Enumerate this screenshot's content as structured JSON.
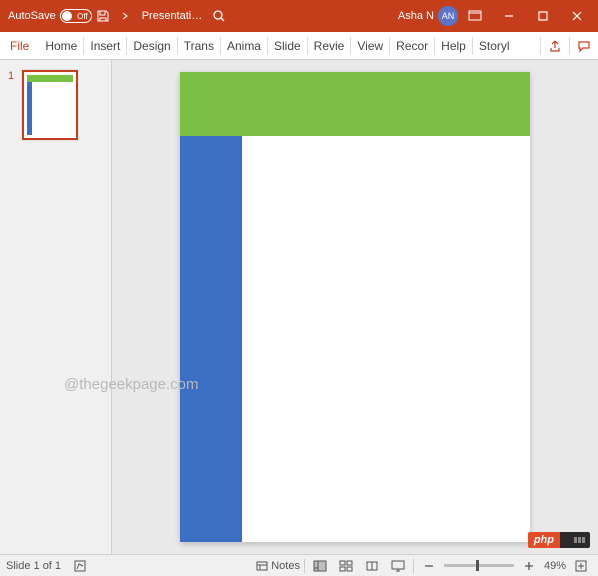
{
  "titlebar": {
    "autosave_label": "AutoSave",
    "autosave_state": "Off",
    "doc_title": "Presentati…",
    "account_name": "Asha N",
    "avatar_initials": "AN"
  },
  "ribbon": {
    "file": "File",
    "tabs": [
      "Home",
      "Insert",
      "Design",
      "Trans",
      "Anima",
      "Slide",
      "Revie",
      "View",
      "Recor",
      "Help",
      "Storyl"
    ]
  },
  "thumbnails": {
    "items": [
      {
        "num": "1"
      }
    ]
  },
  "watermark": "@thegeekpage.com",
  "badge": {
    "text": "php"
  },
  "status": {
    "slide_info": "Slide 1 of 1",
    "notes_label": "Notes",
    "zoom_label": "49%"
  }
}
